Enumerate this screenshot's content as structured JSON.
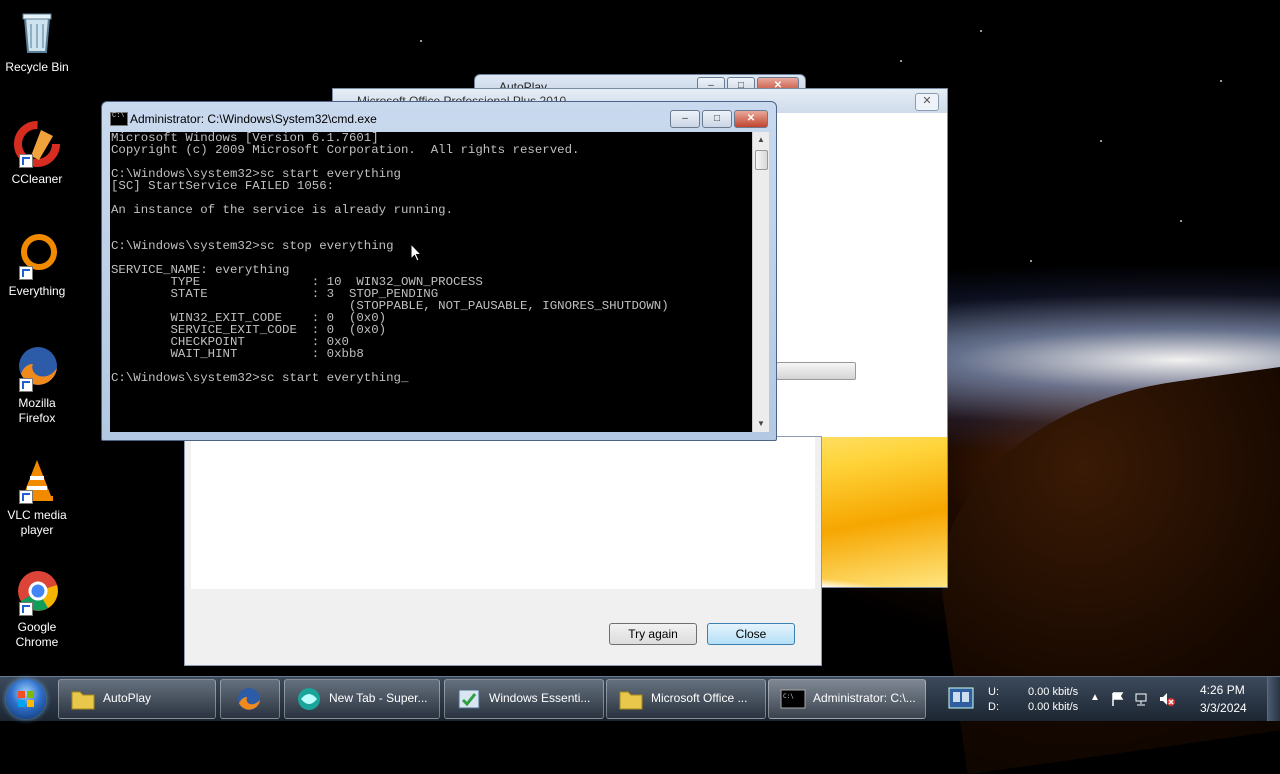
{
  "desktop": {
    "icons": [
      {
        "label": "Recycle Bin"
      },
      {
        "label": "CCleaner"
      },
      {
        "label": "Everything"
      },
      {
        "label": "Mozilla Firefox"
      },
      {
        "label": "VLC media player"
      },
      {
        "label": "Google Chrome"
      }
    ]
  },
  "autoplay_window": {
    "title": "AutoPlay"
  },
  "office_window": {
    "title": "Microsoft Office Professional Plus 2010"
  },
  "error_dialog": {
    "try_again_label": "Try again",
    "close_label": "Close"
  },
  "cmd_window": {
    "title": "Administrator: C:\\Windows\\System32\\cmd.exe",
    "console_lines": [
      "Microsoft Windows [Version 6.1.7601]",
      "Copyright (c) 2009 Microsoft Corporation.  All rights reserved.",
      "",
      "C:\\Windows\\system32>sc start everything",
      "[SC] StartService FAILED 1056:",
      "",
      "An instance of the service is already running.",
      "",
      "",
      "C:\\Windows\\system32>sc stop everything",
      "",
      "SERVICE_NAME: everything",
      "        TYPE               : 10  WIN32_OWN_PROCESS",
      "        STATE              : 3  STOP_PENDING",
      "                                (STOPPABLE, NOT_PAUSABLE, IGNORES_SHUTDOWN)",
      "        WIN32_EXIT_CODE    : 0  (0x0)",
      "        SERVICE_EXIT_CODE  : 0  (0x0)",
      "        CHECKPOINT         : 0x0",
      "        WAIT_HINT          : 0xbb8",
      "",
      "C:\\Windows\\system32>sc start everything_"
    ]
  },
  "taskbar": {
    "buttons": [
      {
        "label": "AutoPlay"
      },
      {
        "label": "New Tab - Super..."
      },
      {
        "label": "Windows Essenti..."
      },
      {
        "label": "Microsoft Office ..."
      },
      {
        "label": "Administrator: C:\\..."
      }
    ],
    "tray": {
      "net_upload_label": "U:",
      "net_download_label": "D:",
      "net_upload_rate": "0.00 kbit/s",
      "net_download_rate": "0.00 kbit/s",
      "time": "4:26 PM",
      "date": "3/3/2024"
    }
  },
  "colors": {
    "console_bg": "#000000",
    "console_fg": "#c0c0c0",
    "close_button": "#c0452f",
    "taskbar": "#1c2632"
  }
}
